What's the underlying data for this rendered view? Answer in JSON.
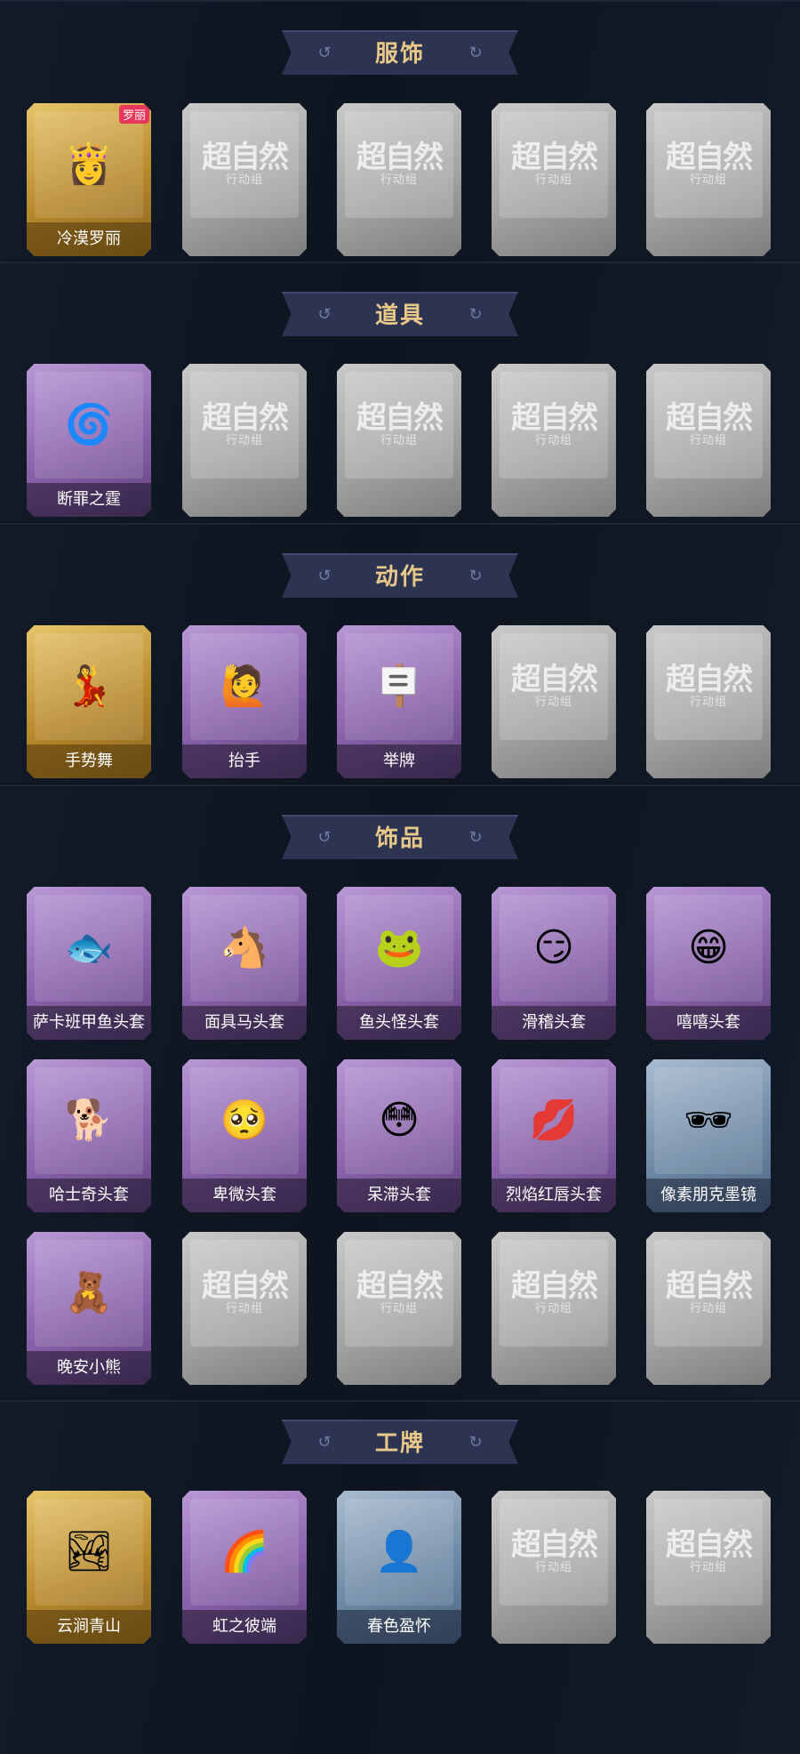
{
  "placeholder": {
    "main": "超自然",
    "sub": "行动组"
  },
  "sections": [
    {
      "title": "服饰",
      "items": [
        {
          "label": "冷漠罗丽",
          "rarity": "gold",
          "icon": "character-portrait-icon",
          "glyph": "👸",
          "badge": "罗丽"
        },
        {
          "label": "",
          "rarity": "empty"
        },
        {
          "label": "",
          "rarity": "empty"
        },
        {
          "label": "",
          "rarity": "empty"
        },
        {
          "label": "",
          "rarity": "empty"
        }
      ]
    },
    {
      "title": "道具",
      "items": [
        {
          "label": "断罪之霆",
          "rarity": "purple",
          "icon": "swirl-weapon-icon",
          "glyph": "🌀"
        },
        {
          "label": "",
          "rarity": "empty"
        },
        {
          "label": "",
          "rarity": "empty"
        },
        {
          "label": "",
          "rarity": "empty"
        },
        {
          "label": "",
          "rarity": "empty"
        }
      ]
    },
    {
      "title": "动作",
      "items": [
        {
          "label": "手势舞",
          "rarity": "gold",
          "icon": "dance-figure-icon",
          "glyph": "💃"
        },
        {
          "label": "抬手",
          "rarity": "purple",
          "icon": "raise-hand-figure-icon",
          "glyph": "🙋"
        },
        {
          "label": "举牌",
          "rarity": "purple",
          "icon": "hold-sign-figure-icon",
          "glyph": "🪧"
        },
        {
          "label": "",
          "rarity": "empty"
        },
        {
          "label": "",
          "rarity": "empty"
        }
      ]
    },
    {
      "title": "饰品",
      "items": [
        {
          "label": "萨卡班甲鱼头套",
          "rarity": "purple",
          "icon": "fish-head-mask-icon",
          "glyph": "🐟"
        },
        {
          "label": "面具马头套",
          "rarity": "purple",
          "icon": "horse-head-mask-icon",
          "glyph": "🐴"
        },
        {
          "label": "鱼头怪头套",
          "rarity": "purple",
          "icon": "fish-monster-mask-icon",
          "glyph": "🐸"
        },
        {
          "label": "滑稽头套",
          "rarity": "purple",
          "icon": "smirk-face-mask-icon",
          "glyph": "😏"
        },
        {
          "label": "嘻嘻头套",
          "rarity": "purple",
          "icon": "grin-face-mask-icon",
          "glyph": "😁"
        },
        {
          "label": "哈士奇头套",
          "rarity": "purple",
          "icon": "husky-head-mask-icon",
          "glyph": "🐕"
        },
        {
          "label": "卑微头套",
          "rarity": "purple",
          "icon": "humble-face-mask-icon",
          "glyph": "🥺"
        },
        {
          "label": "呆滞头套",
          "rarity": "purple",
          "icon": "dazed-face-mask-icon",
          "glyph": "😳"
        },
        {
          "label": "烈焰红唇头套",
          "rarity": "purple",
          "icon": "red-lips-mask-icon",
          "glyph": "💋"
        },
        {
          "label": "像素朋克墨镜",
          "rarity": "blue",
          "icon": "pixel-sunglasses-icon",
          "glyph": "🕶"
        },
        {
          "label": "晚安小熊",
          "rarity": "purple",
          "icon": "teddy-bear-charm-icon",
          "glyph": "🧸"
        },
        {
          "label": "",
          "rarity": "empty"
        },
        {
          "label": "",
          "rarity": "empty"
        },
        {
          "label": "",
          "rarity": "empty"
        },
        {
          "label": "",
          "rarity": "empty"
        }
      ]
    },
    {
      "title": "工牌",
      "items": [
        {
          "label": "云涧青山",
          "rarity": "gold",
          "icon": "landscape-badge-icon",
          "glyph": "🏞"
        },
        {
          "label": "虹之彼端",
          "rarity": "purple",
          "icon": "rainbow-badge-icon",
          "glyph": "🌈"
        },
        {
          "label": "春色盈怀",
          "rarity": "blue",
          "icon": "silhouette-badge-icon",
          "glyph": "👤"
        },
        {
          "label": "",
          "rarity": "empty"
        },
        {
          "label": "",
          "rarity": "empty"
        }
      ]
    }
  ]
}
